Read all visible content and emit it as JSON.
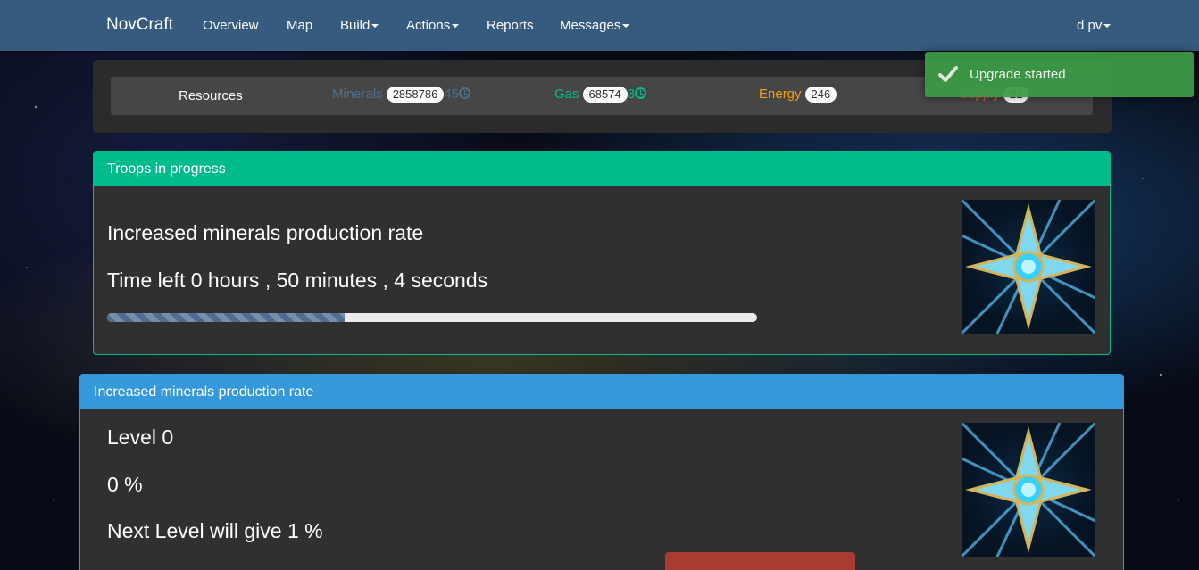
{
  "navbar": {
    "brand": "NovCraft",
    "items": [
      {
        "label": "Overview",
        "dropdown": false
      },
      {
        "label": "Map",
        "dropdown": false
      },
      {
        "label": "Build",
        "dropdown": true
      },
      {
        "label": "Actions",
        "dropdown": true
      },
      {
        "label": "Reports",
        "dropdown": false
      },
      {
        "label": "Messages",
        "dropdown": true
      }
    ],
    "user": "d pv"
  },
  "resources": {
    "title": "Resources",
    "minerals": {
      "label": "Minerals",
      "value": "2858786",
      "rate": "45",
      "color": "#4e6e91"
    },
    "gas": {
      "label": "Gas",
      "value": "68574",
      "rate": "3",
      "color": "#00bc8c"
    },
    "energy": {
      "label": "Energy",
      "value": "246",
      "color": "#f39c12"
    },
    "supply": {
      "label": "Supply",
      "value": "21",
      "color": "#e74c3c"
    }
  },
  "troops_panel": {
    "heading": "Troops in progress",
    "heading_color": "#00bc8c",
    "item_title": "Increased minerals production rate",
    "time_left": "Time left 0 hours , 50 minutes , 4 seconds",
    "progress_fraction": 0.365,
    "image_icon": "mineral-upgrade-icon"
  },
  "upgrade_panel": {
    "heading": "Increased minerals production rate",
    "heading_color": "#3498db",
    "level": "Level 0",
    "percent": "0 %",
    "next_level": "Next Level will give 1 %",
    "image_icon": "mineral-upgrade-icon"
  },
  "toast": {
    "message": "Upgrade started",
    "icon": "check-icon",
    "color": "#3c9a46"
  }
}
